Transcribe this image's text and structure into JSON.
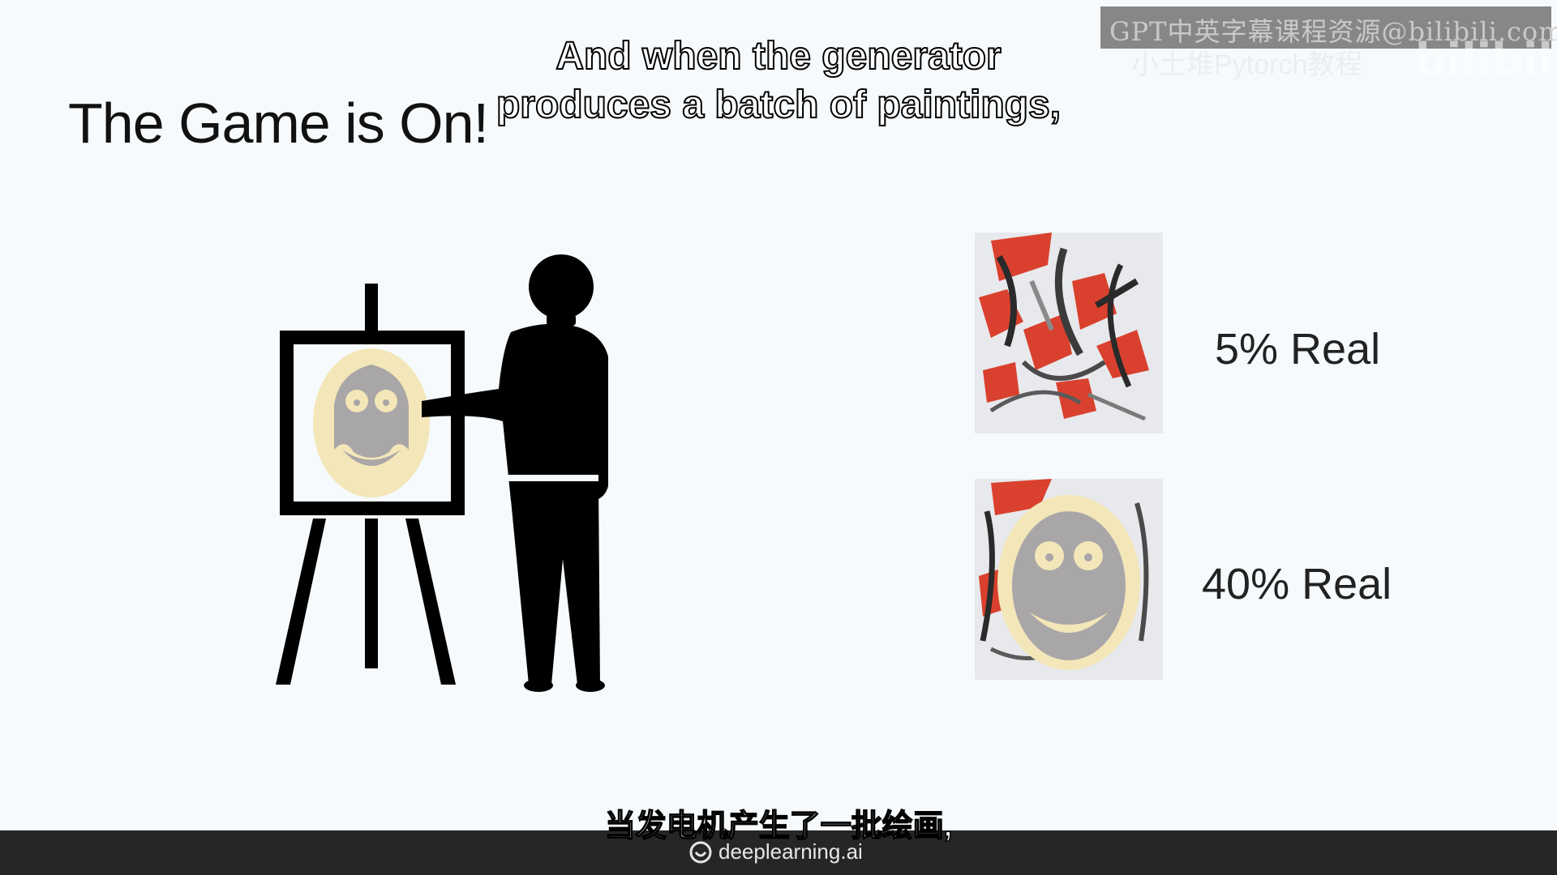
{
  "slide": {
    "title": "The Game is On!"
  },
  "captions": {
    "english_line1": "And when the generator",
    "english_line2": "produces a batch of paintings,",
    "chinese": "当发电机产生了一批绘画,"
  },
  "watermark": {
    "text": "GPT中英字幕课程资源@bilibili.com",
    "subtext": "小土堆Pytorch教程",
    "logo": "bilibili"
  },
  "paintings": [
    {
      "label": "5% Real",
      "style": "abstract"
    },
    {
      "label": "40% Real",
      "style": "smiley-face"
    }
  ],
  "footer": {
    "brand": "deeplearning.ai",
    "icon": "deeplearning-logo-icon"
  },
  "colors": {
    "background": "#f6fafd",
    "face_cream": "#f3e6b8",
    "face_gray": "#a9a6a8",
    "paint_red": "#d9412e",
    "footer_bg": "#262626"
  }
}
